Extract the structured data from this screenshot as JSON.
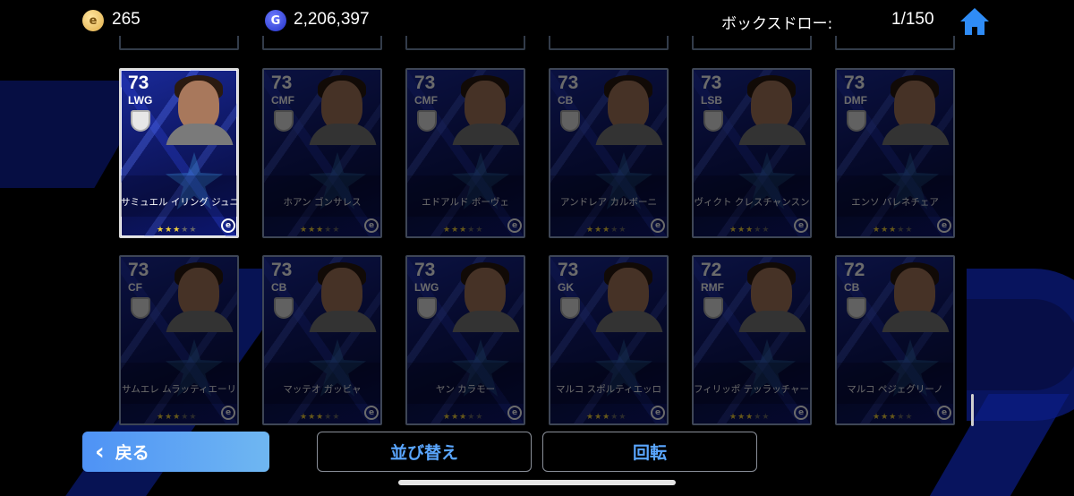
{
  "header": {
    "coins": "265",
    "coin_glyph": "e",
    "gp": "2,206,397",
    "gp_glyph": "G",
    "box_draw_label": "ボックスドロー:",
    "box_draw_count": "1/150",
    "home_icon": "home-icon"
  },
  "cards": [
    {
      "rating": "73",
      "position": "LWG",
      "name": "サミュエル イリング ジュニア",
      "stars": 3,
      "selected": true
    },
    {
      "rating": "73",
      "position": "CMF",
      "name": "ホアン ゴンサレス",
      "stars": 3,
      "selected": false
    },
    {
      "rating": "73",
      "position": "CMF",
      "name": "エドアルド ボーヴェ",
      "stars": 3,
      "selected": false
    },
    {
      "rating": "73",
      "position": "CB",
      "name": "アンドレア カルボーニ",
      "stars": 3,
      "selected": false
    },
    {
      "rating": "73",
      "position": "LSB",
      "name": "ヴィクト クレスチャンスン",
      "stars": 3,
      "selected": false
    },
    {
      "rating": "73",
      "position": "DMF",
      "name": "エンソ バレネチェア",
      "stars": 3,
      "selected": false
    },
    {
      "rating": "73",
      "position": "CF",
      "name": "サムエレ ムラッティエーリ",
      "stars": 3,
      "selected": false
    },
    {
      "rating": "73",
      "position": "CB",
      "name": "マッテオ ガッビャ",
      "stars": 3,
      "selected": false
    },
    {
      "rating": "73",
      "position": "LWG",
      "name": "ヤン カラモー",
      "stars": 3,
      "selected": false
    },
    {
      "rating": "73",
      "position": "GK",
      "name": "マルコ スポルティエッロ",
      "stars": 3,
      "selected": false
    },
    {
      "rating": "72",
      "position": "RMF",
      "name": "フィリッポ テッラッチャーノ",
      "stars": 3,
      "selected": false
    },
    {
      "rating": "72",
      "position": "CB",
      "name": "マルコ ペジェグリーノ",
      "stars": 3,
      "selected": false
    }
  ],
  "footer": {
    "back_label": "戻る",
    "sort_label": "並び替え",
    "rotate_label": "回転"
  },
  "colors": {
    "back_button": "#5aa0f4",
    "outline_text": "#5aa6ff",
    "star_on": "#f2d23c"
  }
}
